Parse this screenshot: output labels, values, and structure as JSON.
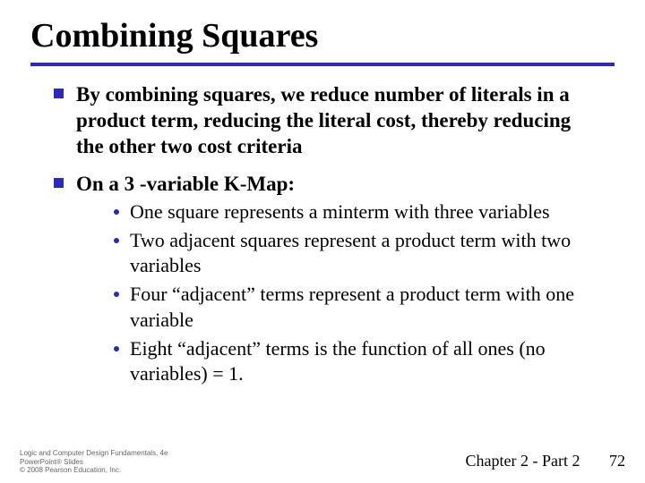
{
  "title": "Combining Squares",
  "bullets": [
    {
      "text": "By combining squares, we reduce number of literals in a product term, reducing the literal cost, thereby reducing the other two cost criteria"
    },
    {
      "text": "On a 3 -variable K-Map:",
      "sub": [
        "One square represents a minterm with three variables",
        "Two adjacent squares represent a product term with two variables",
        "Four “adjacent” terms represent a product term with one variable",
        "Eight “adjacent” terms is the function of all ones (no variables) = 1."
      ]
    }
  ],
  "footer": {
    "line1": "Logic and Computer Design Fundamentals, 4e",
    "line2": "PowerPoint® Slides",
    "line3": "© 2008 Pearson Education, Inc.",
    "chapter": "Chapter 2 - Part 2",
    "page": "72"
  }
}
